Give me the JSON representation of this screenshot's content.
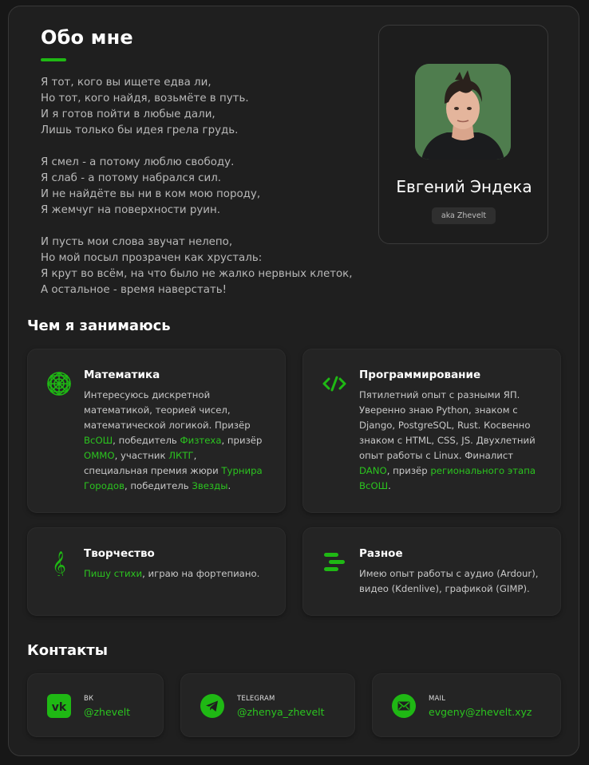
{
  "about": {
    "title": "Обо мне",
    "poem": [
      [
        "Я тот, кого вы ищете едва ли,",
        "Но тот, кого найдя, возьмёте в путь.",
        "И я готов пойти в любые дали,",
        "Лишь только бы идея грела грудь."
      ],
      [
        "Я смел - а потому люблю свободу.",
        "Я слаб - а потому набрался сил.",
        "И не найдёте вы ни в ком мою породу,",
        "Я жемчуг на поверхности руин."
      ],
      [
        "И пусть мои слова звучат нелепо,",
        "Но мой посыл прозрачен как хрусталь:",
        "Я крут во всём, на что было не жалко нервных клеток,",
        "А остальное - время наверстать!"
      ]
    ]
  },
  "profile": {
    "name": "Евгений Эндека",
    "aka": "aka Zhevelt"
  },
  "activities": {
    "title": "Чем я занимаюсь",
    "items": [
      {
        "icon": "math-icon",
        "title": "Математика",
        "parts": [
          {
            "t": "Интересуюсь дискретной математикой, теорией чисел, математической логикой. Призёр "
          },
          {
            "t": "ВсОШ",
            "link": true
          },
          {
            "t": ", победитель "
          },
          {
            "t": "Физтеха",
            "link": true
          },
          {
            "t": ", призёр "
          },
          {
            "t": "ОММО",
            "link": true
          },
          {
            "t": ", участник "
          },
          {
            "t": "ЛКТГ",
            "link": true
          },
          {
            "t": ", специальная премия жюри "
          },
          {
            "t": "Турнира Городов",
            "link": true
          },
          {
            "t": ", победитель "
          },
          {
            "t": "Звезды",
            "link": true
          },
          {
            "t": "."
          }
        ]
      },
      {
        "icon": "code-icon",
        "title": "Программирование",
        "parts": [
          {
            "t": "Пятилетний опыт с разными ЯП. Уверенно знаю Python, знаком с Django, PostgreSQL, Rust. Косвенно знаком с HTML, CSS, JS. Двухлетний опыт работы с Linux. Финалист "
          },
          {
            "t": "DANO",
            "link": true
          },
          {
            "t": ", призёр "
          },
          {
            "t": "регионального этапа ВсОШ",
            "link": true
          },
          {
            "t": "."
          }
        ]
      },
      {
        "icon": "treble-clef-icon",
        "title": "Творчество",
        "parts": [
          {
            "t": "Пишу стихи",
            "link": true
          },
          {
            "t": ", играю на фортепиано."
          }
        ]
      },
      {
        "icon": "misc-icon",
        "title": "Разное",
        "parts": [
          {
            "t": "Имею опыт работы с аудио (Ardour), видео (Kdenlive), графикой (GIMP)."
          }
        ]
      }
    ]
  },
  "contacts": {
    "title": "Контакты",
    "items": [
      {
        "icon": "vk-icon",
        "label": "ВК",
        "value": "@zhevelt"
      },
      {
        "icon": "telegram-icon",
        "label": "TELEGRAM",
        "value": "@zhenya_zhevelt"
      },
      {
        "icon": "mail-icon",
        "label": "MAIL",
        "value": "evgeny@zhevelt.xyz"
      }
    ]
  },
  "colors": {
    "accent": "#1fb814",
    "link": "#2bc41f",
    "background": "#171717",
    "card": "#242424"
  }
}
